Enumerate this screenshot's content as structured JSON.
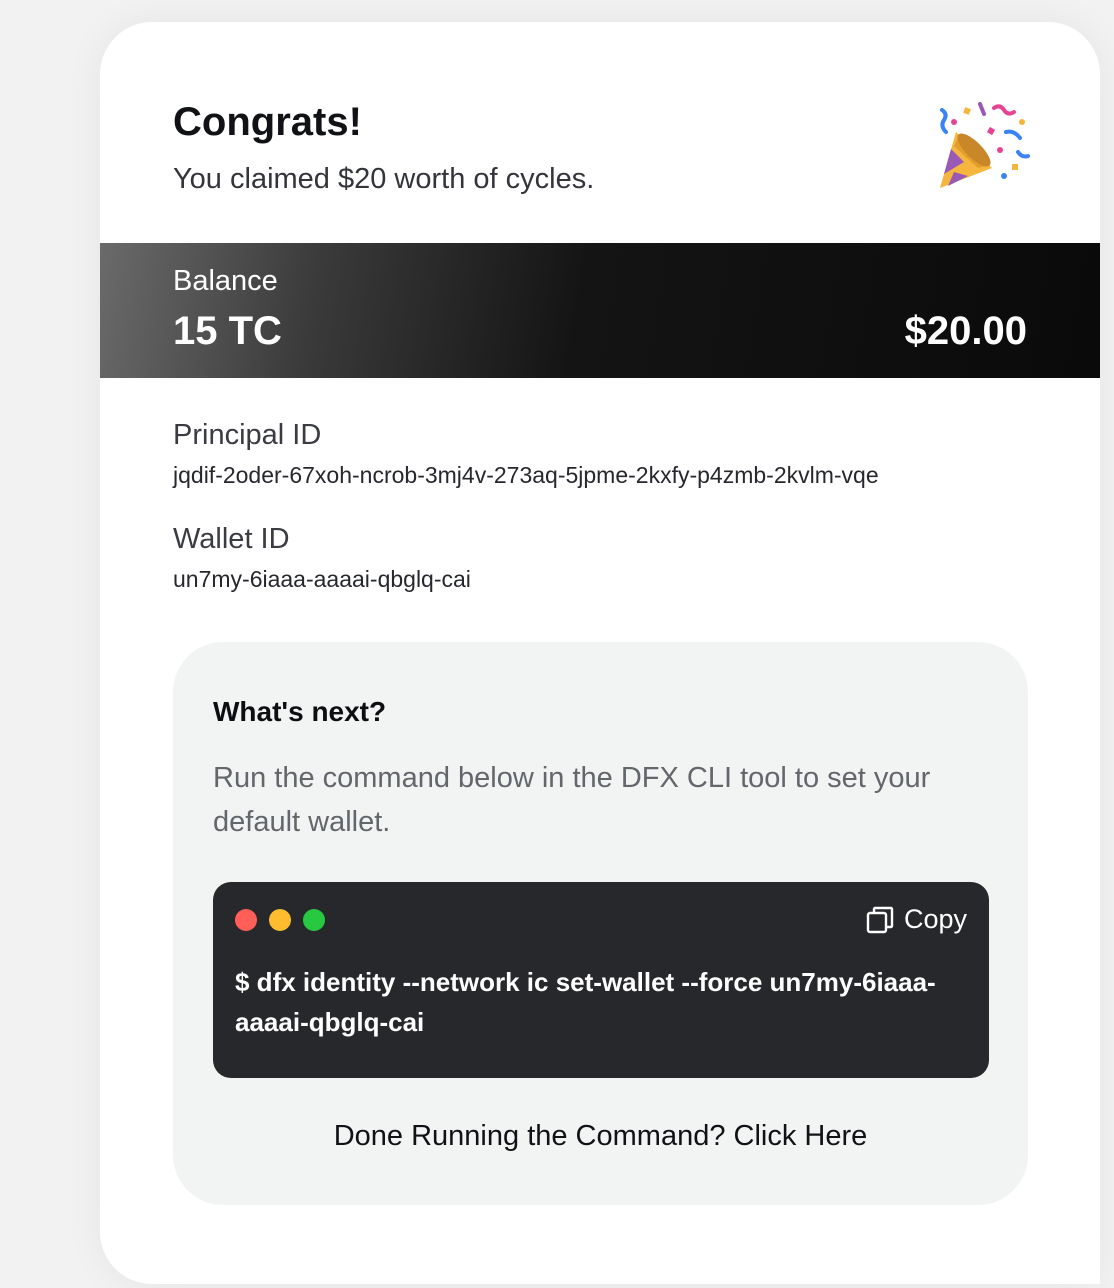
{
  "header": {
    "title": "Congrats!",
    "subtitle": "You claimed $20 worth of cycles.",
    "icon": "party-popper-icon"
  },
  "balance": {
    "label": "Balance",
    "amount": "15 TC",
    "usd": "$20.00"
  },
  "principal": {
    "label": "Principal ID",
    "value": "jqdif-2oder-67xoh-ncrob-3mj4v-273aq-5jpme-2kxfy-p4zmb-2kvlm-vqe"
  },
  "wallet": {
    "label": "Wallet ID",
    "value": "un7my-6iaaa-aaaai-qbglq-cai"
  },
  "next": {
    "title": "What's next?",
    "text": "Run the command below in the DFX CLI tool to set your default wallet.",
    "terminal": {
      "copy_label": "Copy",
      "command": "$ dfx identity --network ic set-wallet --force un7my-6iaaa-aaaai-qbglq-cai",
      "dot_colors": [
        "#ff5f57",
        "#febc2e",
        "#28c840"
      ]
    },
    "done_label": "Done Running the Command? Click Here"
  }
}
